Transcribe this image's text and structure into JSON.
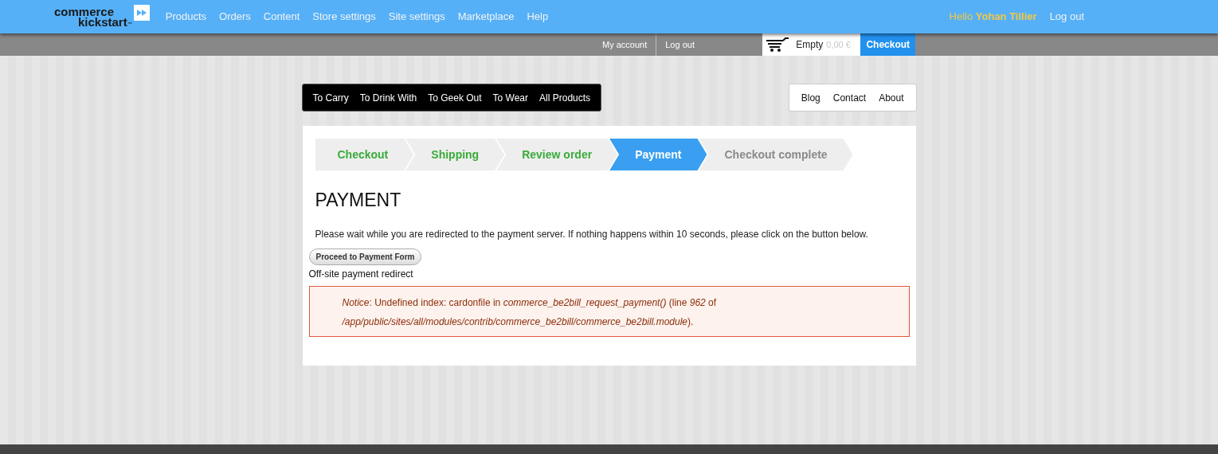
{
  "logo": {
    "line_1": "commerce",
    "line_2": "kickstart",
    "mark": "™"
  },
  "admin_menu": [
    "Products",
    "Orders",
    "Content",
    "Store settings",
    "Site settings",
    "Marketplace",
    "Help"
  ],
  "greeting": {
    "prefix": "Hello",
    "name": "Yohan Tillier"
  },
  "admin_logout": "Log out",
  "user_links": [
    "My account",
    "Log out"
  ],
  "cart": {
    "status": "Empty",
    "total": "0,00 €",
    "checkout": "Checkout"
  },
  "category_menu": [
    "To Carry",
    "To Drink With",
    "To Geek Out",
    "To Wear",
    "All Products"
  ],
  "page_menu": [
    "Blog",
    "Contact",
    "About"
  ],
  "steps": [
    {
      "label": "Checkout",
      "completed": true,
      "selected": false
    },
    {
      "label": "Shipping",
      "completed": true,
      "selected": false
    },
    {
      "label": "Review order",
      "completed": true,
      "selected": false
    },
    {
      "label": "Payment",
      "completed": false,
      "selected": true
    },
    {
      "label": "Checkout complete",
      "completed": false,
      "selected": false
    }
  ],
  "title": "PAYMENT",
  "instructions": "Please wait while you are redirected to the payment server. If nothing happens within 10 seconds, please click on the button below.",
  "submit_button": "Proceed to Payment Form",
  "form_label": "Off-site payment redirect",
  "notice": "*Notice*: Undefined index: cardonfile in *commerce_be2bill_request_payment()* (line *962* of */app/public/sites/all/modules/contrib/commerce_be2bill/commerce_be2bill.module*)."
}
